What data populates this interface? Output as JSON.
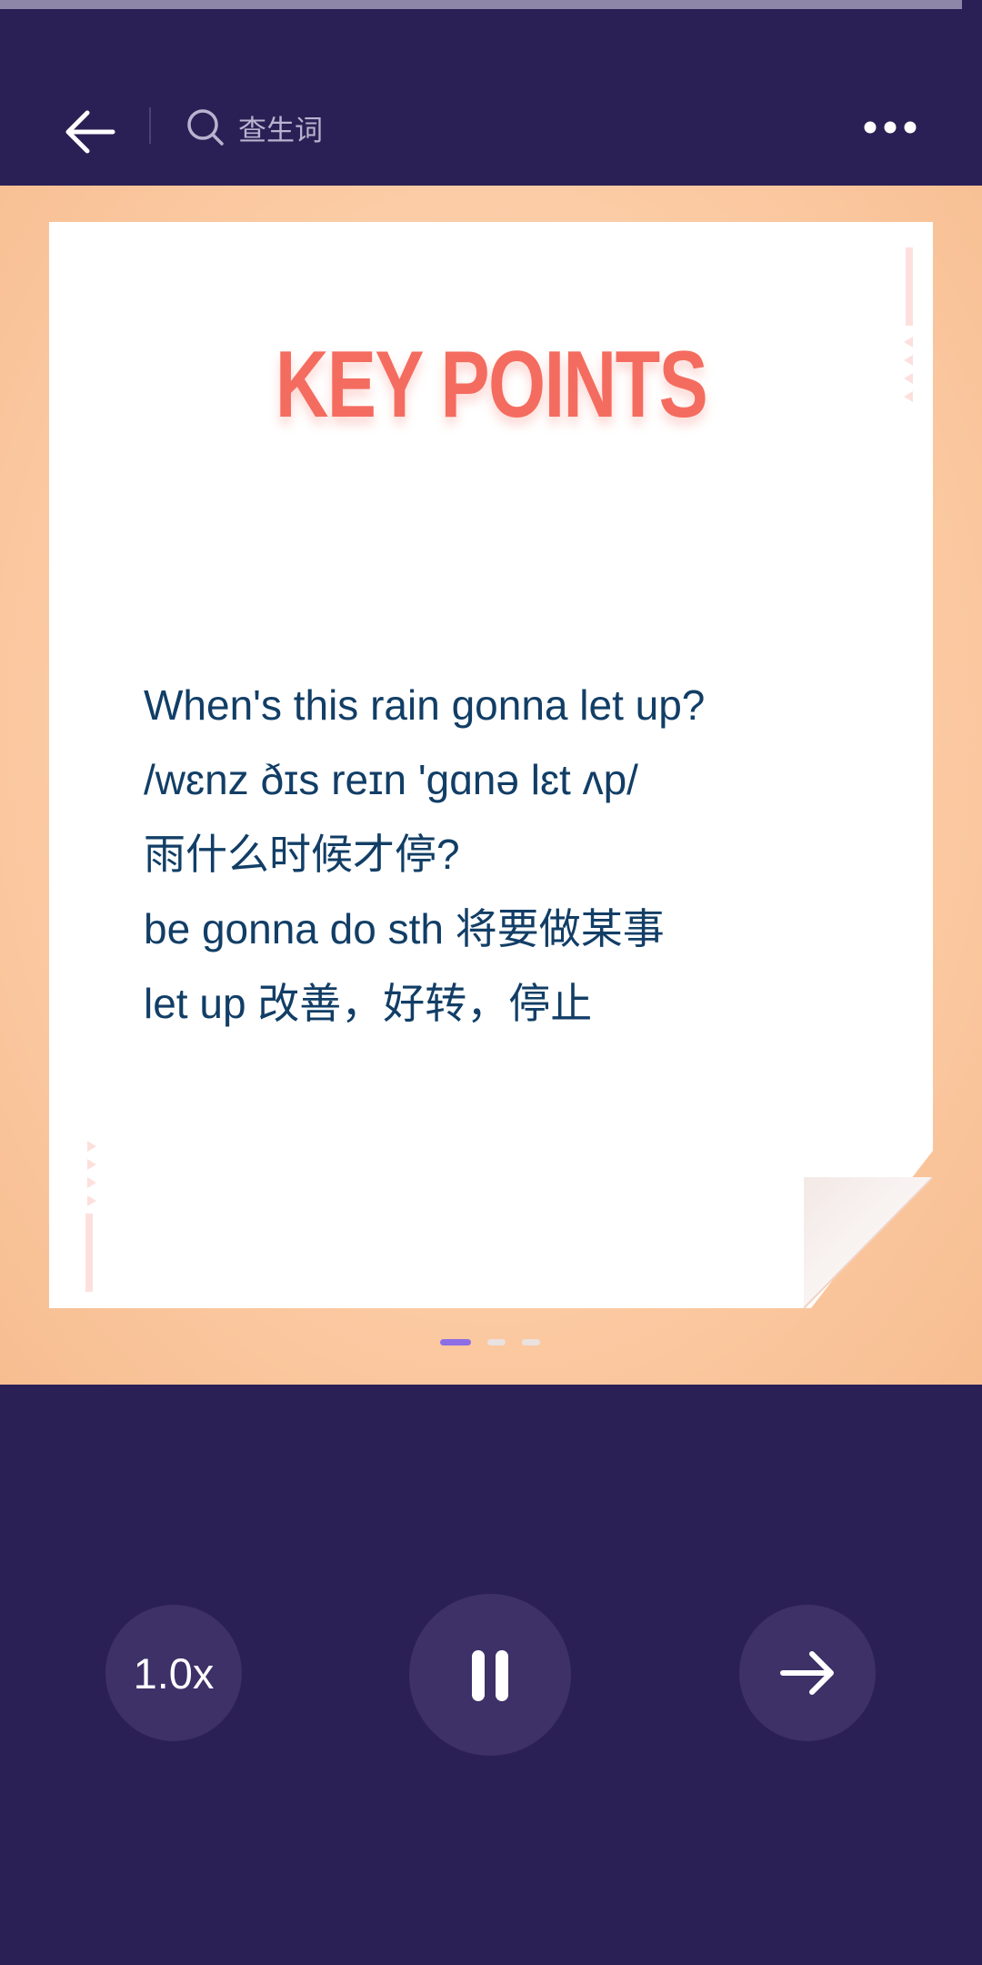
{
  "playback": {
    "progress_fraction": 0.98
  },
  "header": {
    "back_icon": "arrow-left-icon",
    "search_icon": "search-icon",
    "search_placeholder": "查生词",
    "more_icon": "more-horizontal-icon"
  },
  "card": {
    "title": "KEY POINTS",
    "lines": [
      "When's this rain gonna let up?",
      "/wɛnz ðɪs reɪn 'gɑnə lɛt ʌp/",
      "雨什么时候才停?",
      "be gonna do sth 将要做某事",
      "let up 改善，好转，停止"
    ]
  },
  "pager": {
    "count": 3,
    "active_index": 0
  },
  "controls": {
    "speed_label": "1.0x",
    "pause_icon": "pause-icon",
    "next_icon": "arrow-right-icon"
  },
  "colors": {
    "background": "#2b2055",
    "button": "#3d3168",
    "card_bg": "#fbc9a1",
    "title": "#f46c5f",
    "text": "#123e66",
    "accent": "#8c6ee6"
  }
}
